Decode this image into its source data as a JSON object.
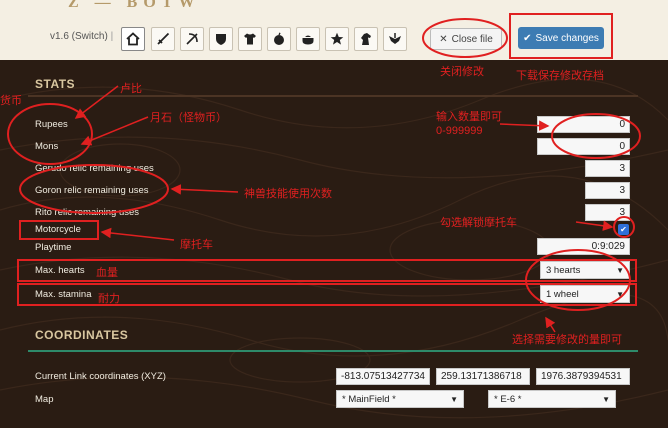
{
  "app": {
    "logo_text": "Z — BOTW",
    "version": "v1.6 (Switch)",
    "separator": "|"
  },
  "toolbar": {
    "icons": [
      "home-icon",
      "sword-icon",
      "bow-icon",
      "shield-icon",
      "shirt-icon",
      "apple-icon",
      "pot-icon",
      "star-icon",
      "horse-icon",
      "crest-icon"
    ],
    "close_label": "Close file",
    "save_label": "Save changes",
    "accent": "#3d7cb3"
  },
  "stats": {
    "heading": "STATS",
    "rupees": {
      "label": "Rupees",
      "value": "0"
    },
    "mons": {
      "label": "Mons",
      "value": "0"
    },
    "gerudo": {
      "label": "Gerudo relic remaining uses",
      "value": "3"
    },
    "goron": {
      "label": "Goron relic remaining uses",
      "value": "3"
    },
    "rito": {
      "label": "Rito relic remaining uses",
      "value": "3"
    },
    "motorcycle": {
      "label": "Motorcycle",
      "checked": true
    },
    "playtime": {
      "label": "Playtime",
      "value": "0:9:029"
    },
    "max_hearts": {
      "label": "Max. hearts",
      "value": "3 hearts"
    },
    "max_stamina": {
      "label": "Max. stamina",
      "value": "1 wheel"
    }
  },
  "coordinates": {
    "heading": "COORDINATES",
    "link_label": "Current Link coordinates (XYZ)",
    "x": "-813.07513427734",
    "y": "259.13171386718",
    "z": "1976.3879394531",
    "map_label": "Map",
    "map_value": "* MainField *",
    "map_area": "* E-6 *"
  },
  "annotations": {
    "currency": "货币",
    "rupees_cn": "卢比",
    "mons_cn": "月石（怪物币）",
    "relic_cn": "神兽技能使用次数",
    "motorcycle_cn": "摩托车",
    "hearts_cn": "血量",
    "stamina_cn": "耐力",
    "close_cn": "关闭修改",
    "save_cn": "下载保存修改存档",
    "qty_cn_1": "输入数量即可",
    "qty_cn_2": "0-999999",
    "check_cn": "勾选解锁摩托车",
    "select_cn": "选择需要修改的量即可"
  }
}
